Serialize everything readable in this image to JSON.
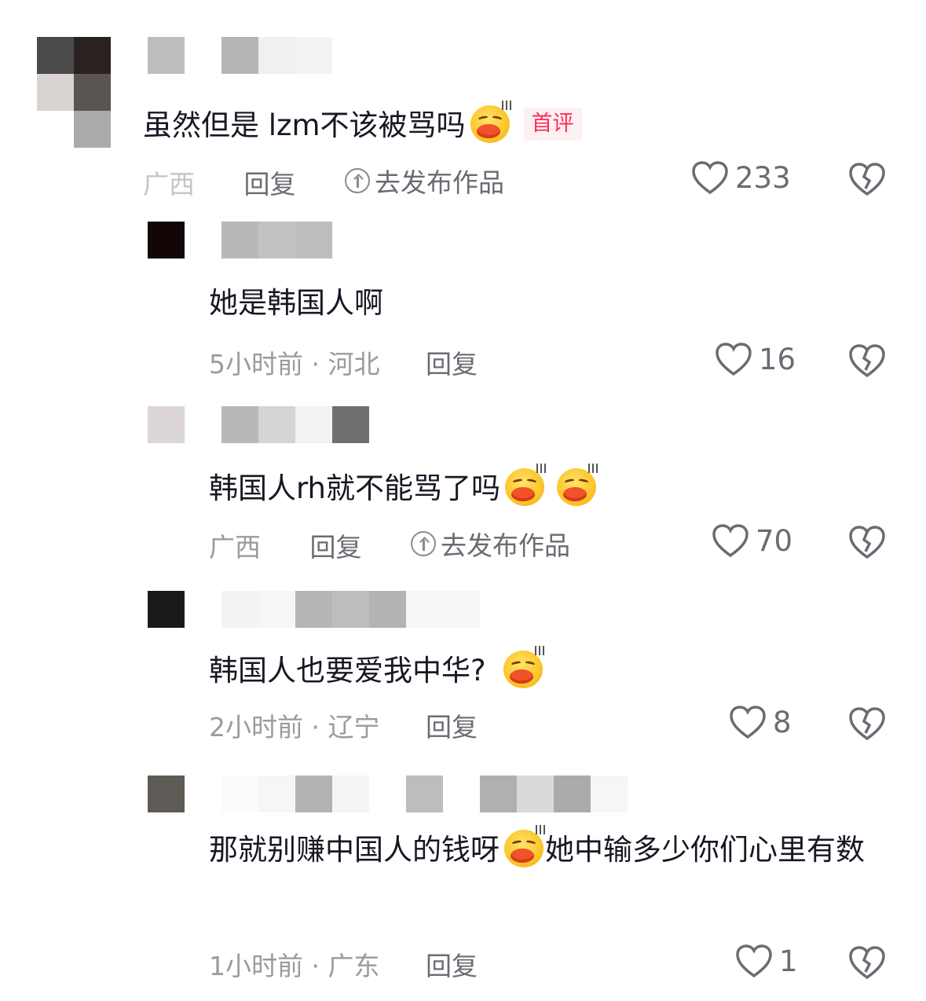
{
  "comments": [
    {
      "text": "虽然但是 lzm不该被骂吗",
      "emoji_count": 1,
      "tag": "首评",
      "meta_time": "",
      "meta_region": "广西",
      "reply_label": "回复",
      "publish_label": "去发布作品",
      "likes": "233"
    },
    {
      "text": "她是韩国人啊",
      "emoji_count": 0,
      "meta_time": "5小时前",
      "meta_region": "河北",
      "reply_label": "回复",
      "likes": "16"
    },
    {
      "text": "韩国人rh就不能骂了吗",
      "emoji_count": 2,
      "meta_region": "广西",
      "reply_label": "回复",
      "publish_label": "去发布作品",
      "likes": "70"
    },
    {
      "text": "韩国人也要爱我中华?",
      "emoji_count": 1,
      "meta_time": "2小时前",
      "meta_region": "辽宁",
      "reply_label": "回复",
      "likes": "8"
    },
    {
      "text_part1": "那就别赚中国人的钱呀",
      "text_part2": "她中输多少你们心里有数",
      "meta_time": "1小时前",
      "meta_region": "广东",
      "reply_label": "回复",
      "likes": "1"
    }
  ],
  "icons": {
    "like": "heart-outline-icon",
    "dislike": "broken-heart-icon",
    "publish": "upload-circle-icon",
    "emoji": "kiss-face-emoji"
  },
  "colors": {
    "text": "#161823",
    "meta": "#9a9aa0",
    "tag_bg": "#fdf0f3",
    "tag_fg": "#fe2c55"
  }
}
